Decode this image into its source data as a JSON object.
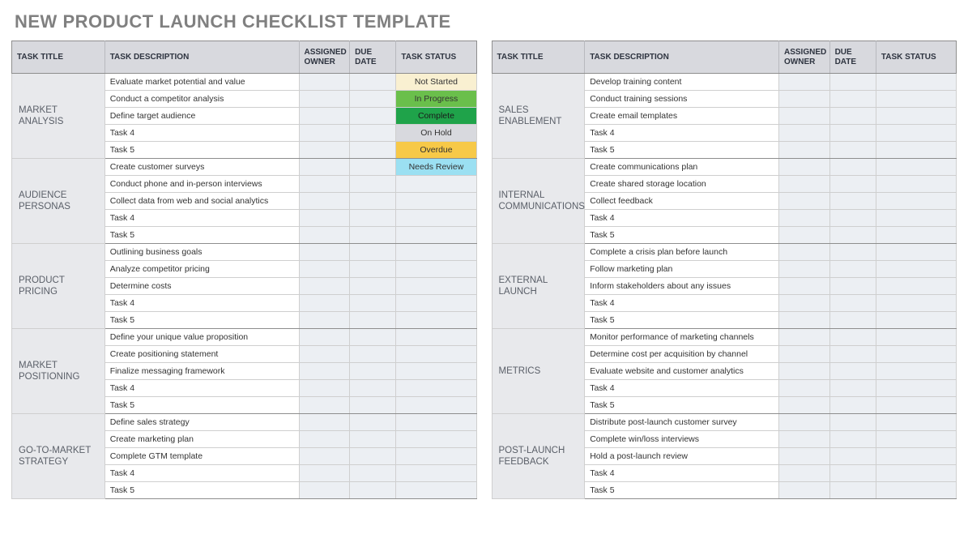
{
  "title": "NEW PRODUCT LAUNCH CHECKLIST TEMPLATE",
  "headers": {
    "task_title": "TASK TITLE",
    "task_description": "TASK DESCRIPTION",
    "assigned_owner": "ASSIGNED OWNER",
    "due_date": "DUE DATE",
    "task_status": "TASK STATUS"
  },
  "status_classes": {
    "Not Started": "st-not-started",
    "In Progress": "st-in-progress",
    "Complete": "st-complete",
    "On Hold": "st-on-hold",
    "Overdue": "st-overdue",
    "Needs Review": "st-needs-review"
  },
  "left_sections": [
    {
      "name": "MARKET ANALYSIS",
      "tasks": [
        {
          "desc": "Evaluate market potential and value",
          "owner": "",
          "due": "",
          "status": "Not Started"
        },
        {
          "desc": "Conduct a competitor analysis",
          "owner": "",
          "due": "",
          "status": "In Progress"
        },
        {
          "desc": "Define target audience",
          "owner": "",
          "due": "",
          "status": "Complete"
        },
        {
          "desc": "Task 4",
          "owner": "",
          "due": "",
          "status": "On Hold"
        },
        {
          "desc": "Task 5",
          "owner": "",
          "due": "",
          "status": "Overdue"
        }
      ]
    },
    {
      "name": "AUDIENCE PERSONAS",
      "tasks": [
        {
          "desc": "Create customer surveys",
          "owner": "",
          "due": "",
          "status": "Needs Review"
        },
        {
          "desc": "Conduct phone and in-person interviews",
          "owner": "",
          "due": "",
          "status": ""
        },
        {
          "desc": "Collect data from web and social analytics",
          "owner": "",
          "due": "",
          "status": ""
        },
        {
          "desc": "Task 4",
          "owner": "",
          "due": "",
          "status": ""
        },
        {
          "desc": "Task 5",
          "owner": "",
          "due": "",
          "status": ""
        }
      ]
    },
    {
      "name": "PRODUCT PRICING",
      "tasks": [
        {
          "desc": "Outlining business goals",
          "owner": "",
          "due": "",
          "status": ""
        },
        {
          "desc": "Analyze competitor pricing",
          "owner": "",
          "due": "",
          "status": ""
        },
        {
          "desc": "Determine costs",
          "owner": "",
          "due": "",
          "status": ""
        },
        {
          "desc": "Task 4",
          "owner": "",
          "due": "",
          "status": ""
        },
        {
          "desc": "Task 5",
          "owner": "",
          "due": "",
          "status": ""
        }
      ]
    },
    {
      "name": "MARKET POSITIONING",
      "tasks": [
        {
          "desc": "Define your unique value proposition",
          "owner": "",
          "due": "",
          "status": ""
        },
        {
          "desc": "Create positioning statement",
          "owner": "",
          "due": "",
          "status": ""
        },
        {
          "desc": "Finalize messaging framework",
          "owner": "",
          "due": "",
          "status": ""
        },
        {
          "desc": "Task 4",
          "owner": "",
          "due": "",
          "status": ""
        },
        {
          "desc": "Task 5",
          "owner": "",
          "due": "",
          "status": ""
        }
      ]
    },
    {
      "name": "GO-TO-MARKET STRATEGY",
      "tasks": [
        {
          "desc": "Define sales strategy",
          "owner": "",
          "due": "",
          "status": ""
        },
        {
          "desc": "Create marketing plan",
          "owner": "",
          "due": "",
          "status": ""
        },
        {
          "desc": "Complete GTM template",
          "owner": "",
          "due": "",
          "status": ""
        },
        {
          "desc": "Task 4",
          "owner": "",
          "due": "",
          "status": ""
        },
        {
          "desc": "Task 5",
          "owner": "",
          "due": "",
          "status": ""
        }
      ]
    }
  ],
  "right_sections": [
    {
      "name": "SALES ENABLEMENT",
      "tasks": [
        {
          "desc": "Develop training content",
          "owner": "",
          "due": "",
          "status": ""
        },
        {
          "desc": "Conduct training sessions",
          "owner": "",
          "due": "",
          "status": ""
        },
        {
          "desc": "Create email templates",
          "owner": "",
          "due": "",
          "status": ""
        },
        {
          "desc": "Task 4",
          "owner": "",
          "due": "",
          "status": ""
        },
        {
          "desc": "Task 5",
          "owner": "",
          "due": "",
          "status": ""
        }
      ]
    },
    {
      "name": "INTERNAL COMMUNICATIONS",
      "tasks": [
        {
          "desc": "Create communications plan",
          "owner": "",
          "due": "",
          "status": ""
        },
        {
          "desc": "Create shared storage location",
          "owner": "",
          "due": "",
          "status": ""
        },
        {
          "desc": "Collect feedback",
          "owner": "",
          "due": "",
          "status": ""
        },
        {
          "desc": "Task 4",
          "owner": "",
          "due": "",
          "status": ""
        },
        {
          "desc": "Task 5",
          "owner": "",
          "due": "",
          "status": ""
        }
      ]
    },
    {
      "name": "EXTERNAL LAUNCH",
      "tasks": [
        {
          "desc": "Complete a crisis plan before launch",
          "owner": "",
          "due": "",
          "status": ""
        },
        {
          "desc": "Follow marketing plan",
          "owner": "",
          "due": "",
          "status": ""
        },
        {
          "desc": "Inform stakeholders about any issues",
          "owner": "",
          "due": "",
          "status": ""
        },
        {
          "desc": "Task 4",
          "owner": "",
          "due": "",
          "status": ""
        },
        {
          "desc": "Task 5",
          "owner": "",
          "due": "",
          "status": ""
        }
      ]
    },
    {
      "name": "METRICS",
      "tasks": [
        {
          "desc": "Monitor performance of marketing channels",
          "owner": "",
          "due": "",
          "status": ""
        },
        {
          "desc": "Determine cost per acquisition by channel",
          "owner": "",
          "due": "",
          "status": ""
        },
        {
          "desc": "Evaluate website and customer analytics",
          "owner": "",
          "due": "",
          "status": ""
        },
        {
          "desc": "Task 4",
          "owner": "",
          "due": "",
          "status": ""
        },
        {
          "desc": "Task 5",
          "owner": "",
          "due": "",
          "status": ""
        }
      ]
    },
    {
      "name": "POST-LAUNCH FEEDBACK",
      "tasks": [
        {
          "desc": "Distribute post-launch customer survey",
          "owner": "",
          "due": "",
          "status": ""
        },
        {
          "desc": "Complete win/loss interviews",
          "owner": "",
          "due": "",
          "status": ""
        },
        {
          "desc": "Hold a post-launch review",
          "owner": "",
          "due": "",
          "status": ""
        },
        {
          "desc": "Task 4",
          "owner": "",
          "due": "",
          "status": ""
        },
        {
          "desc": "Task 5",
          "owner": "",
          "due": "",
          "status": ""
        }
      ]
    }
  ]
}
